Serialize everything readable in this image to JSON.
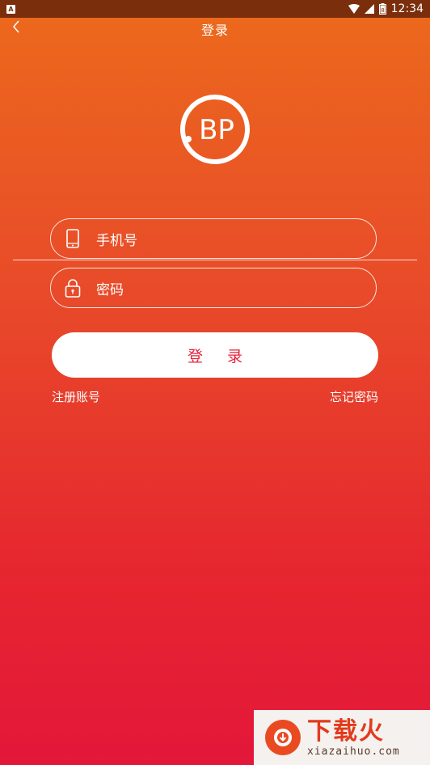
{
  "status_bar": {
    "time": "12:34",
    "app_icon_letter": "A",
    "battery_level": "8"
  },
  "header": {
    "title": "登录"
  },
  "logo": {
    "text": "BP"
  },
  "form": {
    "phone_placeholder": "手机号",
    "password_placeholder": "密码"
  },
  "login_button": "登 录",
  "links": {
    "register": "注册账号",
    "forgot": "忘记密码"
  },
  "watermark": {
    "cn": "下载火",
    "en": "xiazaihuo.com"
  },
  "colors": {
    "accent": "#e4223b",
    "gradient_top": "#ec6a1c",
    "gradient_bottom": "#e3173a"
  }
}
